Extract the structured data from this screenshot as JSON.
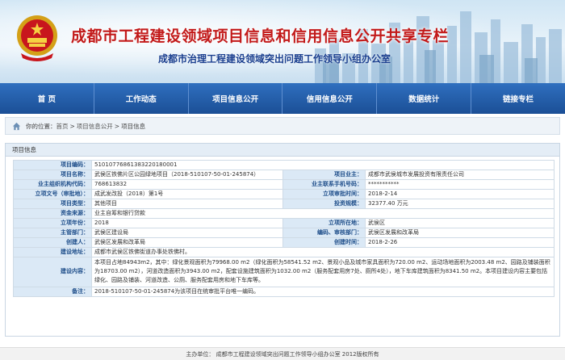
{
  "header": {
    "title": "成都市工程建设领域项目信息和信用信息公开共享专栏",
    "subtitle": "成都市治理工程建设领域突出问题工作领导小组办公室"
  },
  "nav": [
    {
      "label": "首 页"
    },
    {
      "label": "工作动态"
    },
    {
      "label": "项目信息公开"
    },
    {
      "label": "信用信息公开"
    },
    {
      "label": "数据统计"
    },
    {
      "label": "链接专栏"
    }
  ],
  "breadcrumb": {
    "prefix": "你的位置：",
    "home": "首页",
    "sep": ">",
    "level1": "项目信息公开",
    "level2": "项目信息"
  },
  "panel": {
    "title": "项目信息"
  },
  "info": {
    "project_code_label": "项目编码：",
    "project_code": "51010776861383220180001",
    "project_name_label": "项目名称：",
    "project_name": "武侯区铁佛片区公园绿地项目（2018-510107-50-01-245874）",
    "owner_label": "项目业主：",
    "owner": "成都市武侯城市发展投资有限责任公司",
    "org_code_label": "业主组织机构代码：",
    "org_code": "768613832",
    "phone_label": "业主联系手机号码：",
    "phone": "***********",
    "approval_doc_label": "立项文号（审批地）：",
    "approval_doc": "成武发改投（2018）第1号",
    "approval_date_label": "立项审批时间：",
    "approval_date": "2018-2-14",
    "type_label": "项目类型：",
    "type": "其他项目",
    "investment_label": "投资规模：",
    "investment": "32377.40 万元",
    "fund_label": "资金来源：",
    "fund": "业主自筹和银行贷款",
    "year_label": "立项年份：",
    "year": "2018",
    "district_label": "立项所在地：",
    "district": "武侯区",
    "dept_label": "主管部门：",
    "dept": "武侯区建设局",
    "supervise_label": "编码、审核部门：",
    "supervise": "武侯区发展和改革局",
    "creator_label": "创建人：",
    "creator": "武侯区发展和改革局",
    "create_time_label": "创建时间：",
    "create_time": "2018-2-26",
    "address_label": "建设地址：",
    "address": "成都市武侯区铁佛街道办事处铁佛村。",
    "content_label": "建设内容：",
    "content": "本项目占地84943m2，其中：绿化景观面积为79968.00 m2（绿化面积为58541.52 m2、景观小品及城市家具面积为720.00 m2、运动场地面积为2003.48 m2、园路及铺装面积为18703.00 m2），河道改造面积为3943.00 m2，配套设施建筑面积为1032.00 m2（服务配套用房7处、厕所4处），地下车库建筑面积为8341.50 m2。本项目建设内容主要包括绿化、园路及铺装、河道改造、公厕、服务配套用房和地下车库等。",
    "remark_label": "备注：",
    "remark": "2018-510107-50-01-245874为该项目在统审批平台唯一编码。"
  },
  "footer": {
    "text": "主办单位：  成都市工程建设领域突出问题工作领导小组办公室  2012版权所有"
  },
  "colors": {
    "title_red": "#c21a1a",
    "subtitle_blue": "#1a3f8f",
    "nav_blue": "#1b4f96",
    "label_bg": "#dbe9f6",
    "label_text": "#1f4e8a"
  }
}
